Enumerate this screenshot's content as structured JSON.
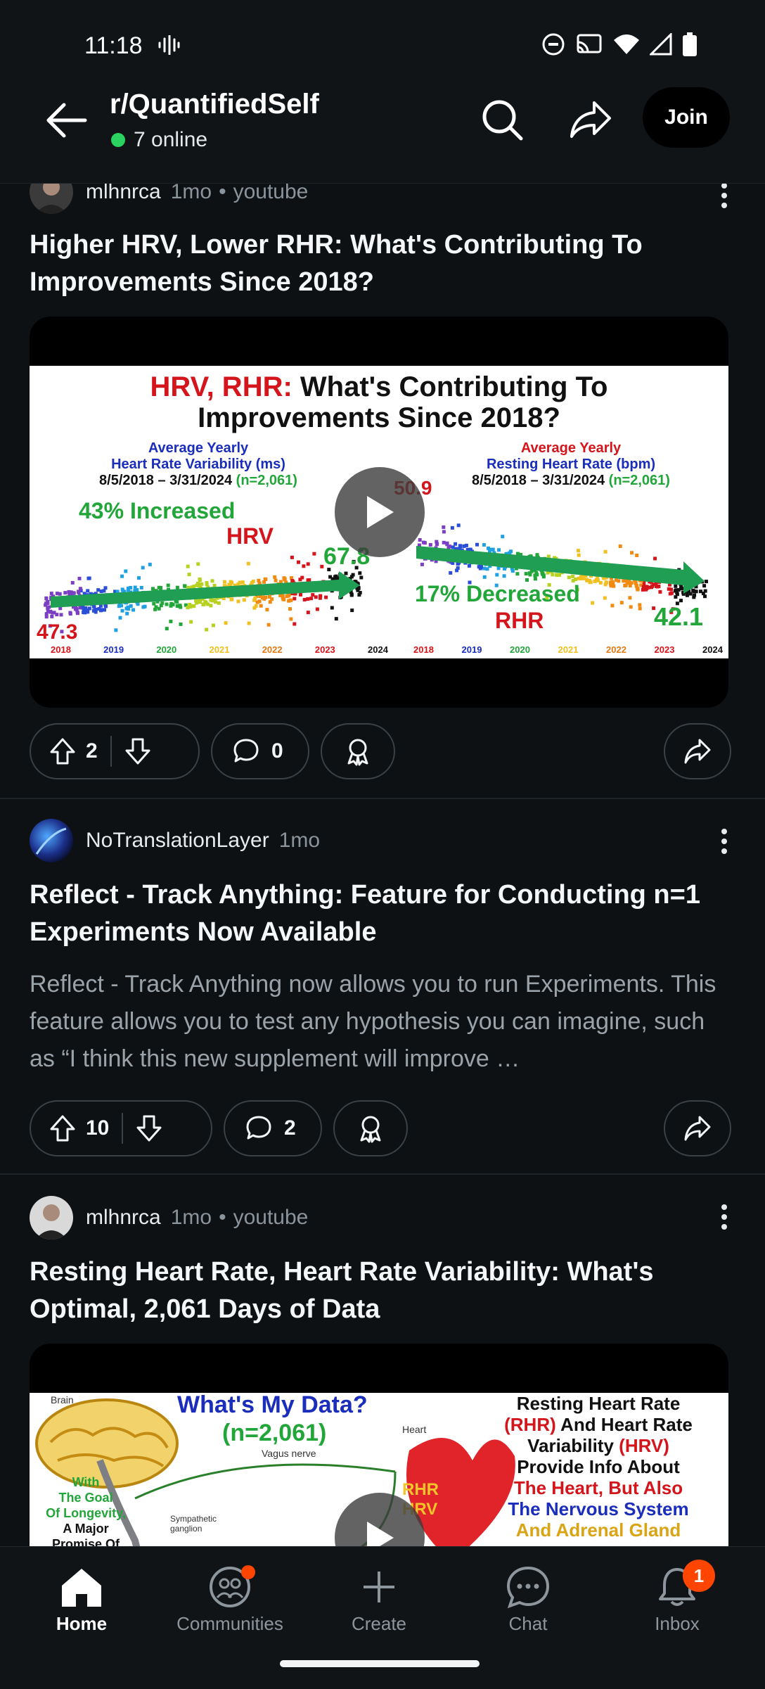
{
  "status_bar": {
    "time": "11:18"
  },
  "header": {
    "title": "r/QuantifiedSelf",
    "online": "7 online",
    "join_label": "Join"
  },
  "posts": [
    {
      "author": "mlhnrca",
      "age": "1mo",
      "source": "youtube",
      "title": "Higher HRV, Lower RHR: What's Contributing To Improvements Since 2018?",
      "thumbnail": {
        "headline_1_red": "HRV, RHR:",
        "headline_1_black": "What's Contributing To",
        "headline_2": "Improvements Since 2018?",
        "left_caption_1": "Average Yearly",
        "left_caption_2": "Heart Rate Variability (ms)",
        "left_range": "8/5/2018 – 3/31/2024",
        "left_n": "(n=2,061)",
        "right_caption_1": "Average Yearly",
        "right_caption_2": "Resting Heart Rate (bpm)",
        "right_range": "8/5/2018 – 3/31/2024",
        "right_n": "(n=2,061)",
        "left_stat_1": "43% Increased",
        "left_stat_2": "HRV",
        "left_start": "47.3",
        "left_end": "67.8",
        "right_stat_1": "17% Decreased",
        "right_stat_2": "RHR",
        "right_start": "50.9",
        "right_end": "42.1",
        "years": [
          "2018",
          "2019",
          "2020",
          "2021",
          "2022",
          "2023",
          "2024"
        ]
      },
      "upvotes": "2",
      "comments": "0"
    },
    {
      "author": "NoTranslationLayer",
      "age": "1mo",
      "title": "Reflect - Track Anything: Feature for Conducting n=1 Experiments Now Available",
      "body": "Reflect - Track Anything now allows you to run Experiments. This feature allows you to test any hypothesis you can imagine, such as “I think this new supplement will improve …",
      "upvotes": "10",
      "comments": "2"
    },
    {
      "author": "mlhnrca",
      "age": "1mo",
      "source": "youtube",
      "title": "Resting Heart Rate, Heart Rate Variability: What's Optimal, 2,061 Days of Data",
      "thumbnail": {
        "brain_label": "Brain",
        "heart_label": "Heart",
        "vagus_label": "Vagus nerve",
        "sympathetic_label": "Sympathetic ganglion",
        "headline": "What's My Data?",
        "n": "(n=2,061)",
        "rhr_tag": "RHR",
        "hrv_tag": "HRV",
        "goal_1": "With",
        "goal_2": "The Goal",
        "goal_3": "Of Longevity,",
        "goal_4": "A Major",
        "goal_5": "Promise Of",
        "right_1": "Resting Heart Rate",
        "right_2_red": "(RHR)",
        "right_2_black": "And Heart Rate",
        "right_3": "Variability",
        "right_3_red": "(HRV)",
        "right_4": "Provide Info About",
        "right_5": "The Heart, But Also",
        "right_6": "The Nervous System",
        "right_7": "And Adrenal Gland"
      }
    }
  ],
  "bottom_nav": [
    {
      "label": "Home",
      "active": true
    },
    {
      "label": "Communities"
    },
    {
      "label": "Create"
    },
    {
      "label": "Chat"
    },
    {
      "label": "Inbox",
      "badge": "1"
    }
  ],
  "colors": {
    "accent": "#ff4500",
    "online": "#2bd25f",
    "background": "#0e1113"
  }
}
